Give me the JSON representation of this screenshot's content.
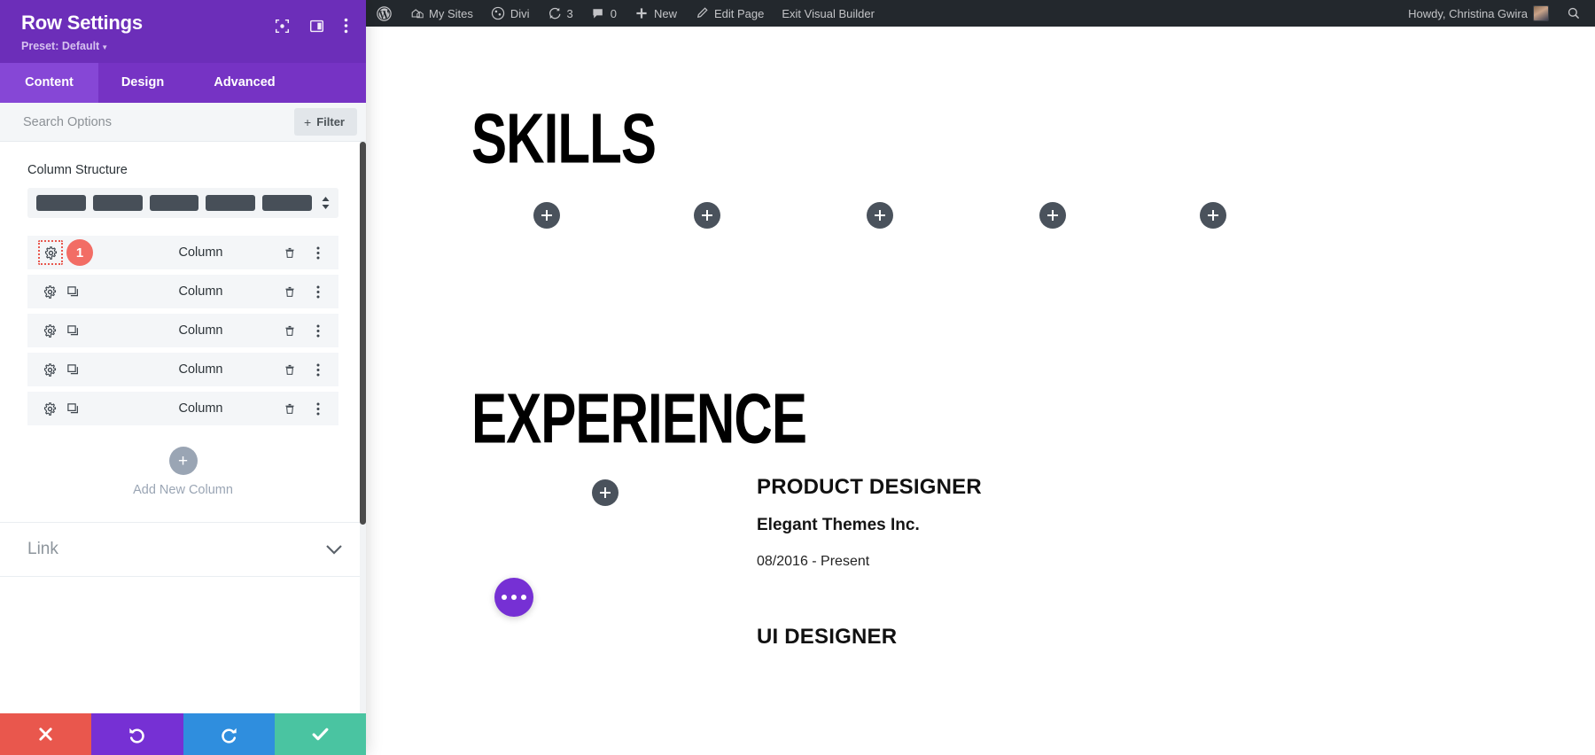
{
  "panel": {
    "title": "Row Settings",
    "preset_label": "Preset: Default",
    "header_icons": [
      {
        "name": "focus-target-icon"
      },
      {
        "name": "panel-layout-icon"
      },
      {
        "name": "more-vertical-icon"
      }
    ],
    "tabs": [
      {
        "label": "Content",
        "active": true
      },
      {
        "label": "Design",
        "active": false
      },
      {
        "label": "Advanced",
        "active": false
      }
    ],
    "search": {
      "value": "",
      "placeholder": "Search Options"
    },
    "filter_button": {
      "label": "Filter",
      "plus": "+"
    },
    "column_structure": {
      "label": "Column Structure",
      "segments": 5
    },
    "columns": [
      {
        "label": "Column",
        "badge": "1",
        "highlighted": true
      },
      {
        "label": "Column",
        "badge": "",
        "highlighted": false
      },
      {
        "label": "Column",
        "badge": "",
        "highlighted": false
      },
      {
        "label": "Column",
        "badge": "",
        "highlighted": false
      },
      {
        "label": "Column",
        "badge": "",
        "highlighted": false
      }
    ],
    "add_column": {
      "label": "Add New Column",
      "plus": "+"
    },
    "link_section": {
      "label": "Link"
    },
    "footer": {
      "cancel": "cancel-icon",
      "undo": "undo-icon",
      "redo": "redo-icon",
      "save": "save-check-icon"
    },
    "colors": {
      "header_purple": "#6c2eb9",
      "tab_purple": "#7633c4",
      "tab_active_purple": "#8647d6",
      "badge_red": "#f26d65",
      "cancel_red": "#e9574d",
      "undo_purple": "#7630d4",
      "redo_blue": "#2f8ede",
      "save_green": "#4ac4a1",
      "structure_slate": "#474f58"
    }
  },
  "admin_bar": {
    "items": [
      {
        "icon": "wordpress-logo-icon",
        "label": ""
      },
      {
        "icon": "multisite-icon",
        "label": "My Sites"
      },
      {
        "icon": "divi-logo-icon",
        "label": "Divi"
      },
      {
        "icon": "updates-icon",
        "label": "3"
      },
      {
        "icon": "comments-icon",
        "label": "0"
      },
      {
        "icon": "plus-icon",
        "label": "New"
      },
      {
        "icon": "pencil-icon",
        "label": "Edit Page"
      },
      {
        "icon": "",
        "label": "Exit Visual Builder"
      }
    ],
    "account": {
      "greeting": "Howdy, Christina Gwira",
      "avatar": "user-avatar"
    },
    "search_icon": "search-icon"
  },
  "canvas": {
    "skills": {
      "title": "SKILLS",
      "module_plus_count": 5
    },
    "experience": {
      "title": "EXPERIENCE",
      "jobs": [
        {
          "title": "PRODUCT DESIGNER",
          "company": "Elegant Themes Inc.",
          "dates": "08/2016 - Present"
        },
        {
          "title": "UI DESIGNER",
          "company": "",
          "dates": ""
        }
      ]
    },
    "fab": {
      "name": "divi-page-settings-fab",
      "glyph": "•••"
    }
  }
}
